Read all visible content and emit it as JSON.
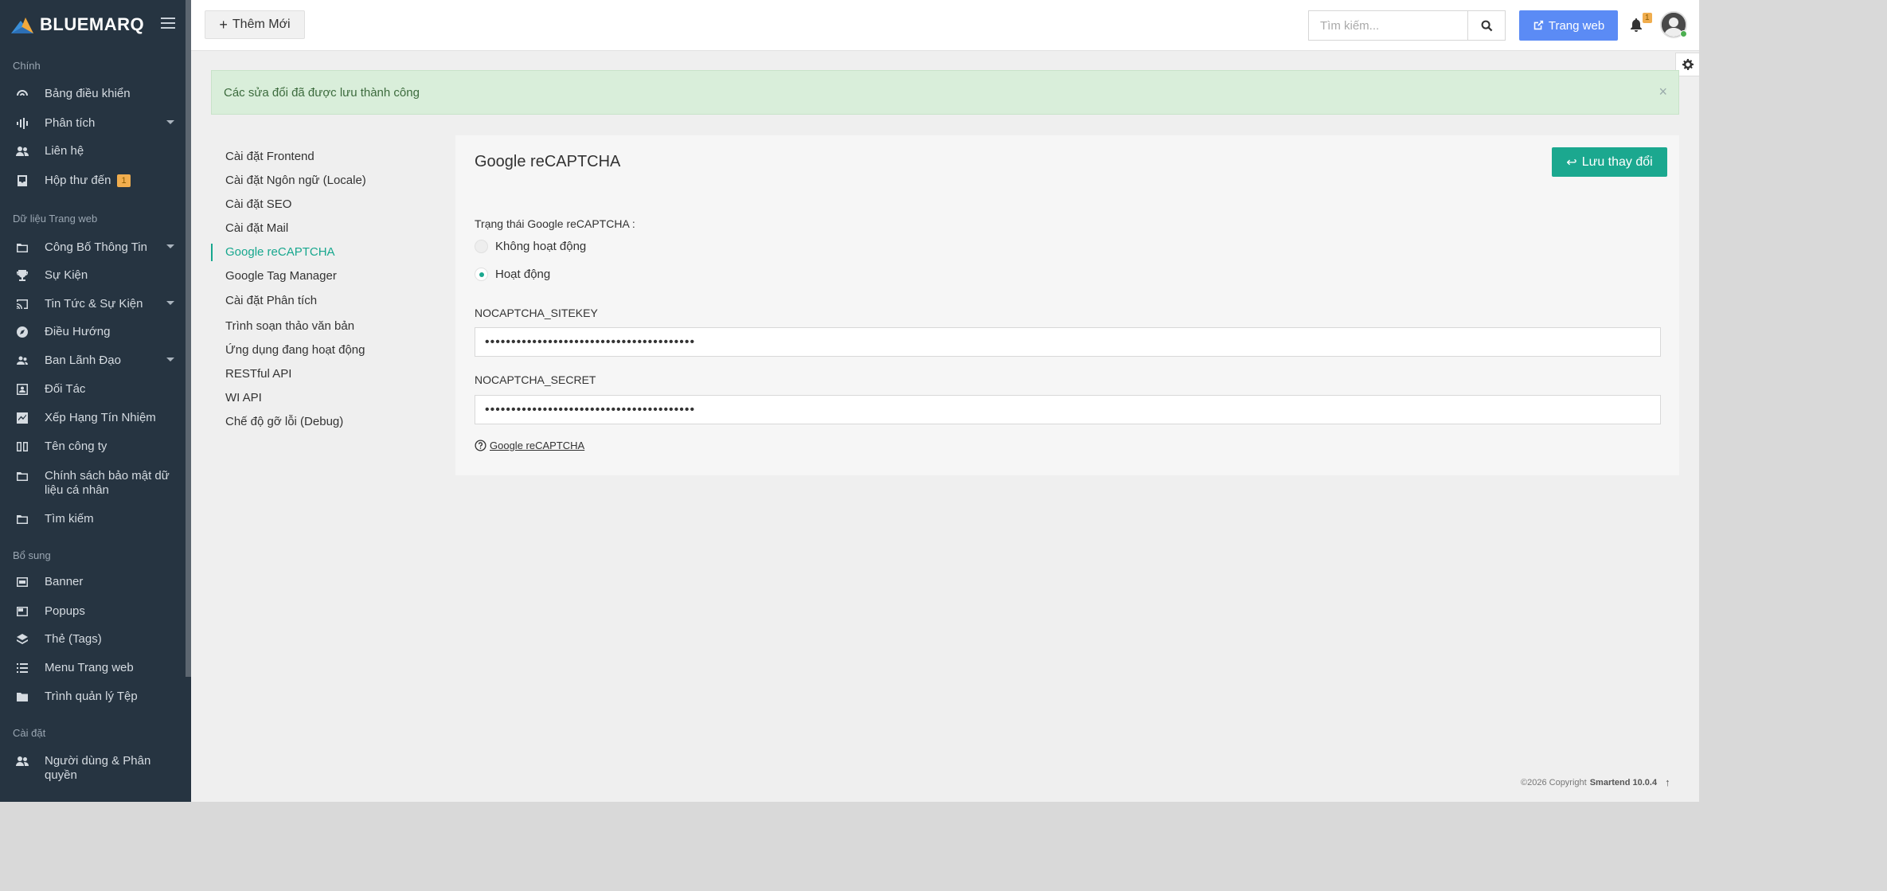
{
  "brand": {
    "name": "BLUEMARQ"
  },
  "sidebar": {
    "sections": [
      {
        "title": "Chính"
      },
      {
        "title": "Dữ liệu Trang web"
      },
      {
        "title": "Bổ sung"
      },
      {
        "title": "Cài đặt"
      }
    ],
    "items": [
      {
        "label": "Bảng điều khiển",
        "icon": "dashboard-icon"
      },
      {
        "label": "Phân tích",
        "icon": "analytics-icon"
      },
      {
        "label": "Liên hệ",
        "icon": "contacts-icon"
      },
      {
        "label": "Hộp thư đến",
        "icon": "inbox-icon",
        "badge": "1"
      },
      {
        "label": "Công Bố Thông Tin",
        "icon": "folder-icon"
      },
      {
        "label": "Sự Kiện",
        "icon": "trophy-icon"
      },
      {
        "label": "Tin Tức & Sự Kiện",
        "icon": "cast-icon"
      },
      {
        "label": "Điều Hướng",
        "icon": "compass-icon"
      },
      {
        "label": "Ban Lãnh Đạo",
        "icon": "people-icon"
      },
      {
        "label": "Đối Tác",
        "icon": "portrait-icon"
      },
      {
        "label": "Xếp Hạng Tín Nhiệm",
        "icon": "chart-icon"
      },
      {
        "label": "Tên công ty",
        "icon": "book-icon"
      },
      {
        "label": "Chính sách bảo mật dữ liệu cá nhân",
        "icon": "folder-icon"
      },
      {
        "label": "Tìm kiếm",
        "icon": "folder-icon"
      },
      {
        "label": "Banner",
        "icon": "banner-icon"
      },
      {
        "label": "Popups",
        "icon": "popup-icon"
      },
      {
        "label": "Thẻ (Tags)",
        "icon": "layers-icon"
      },
      {
        "label": "Menu Trang web",
        "icon": "list-icon"
      },
      {
        "label": "Trình quản lý Tệp",
        "icon": "folder-filled-icon"
      },
      {
        "label": "Người dùng & Phân quyền",
        "icon": "users-icon"
      }
    ]
  },
  "header": {
    "new_label": "Thêm Mới",
    "search_placeholder": "Tìm kiếm...",
    "website_label": "Trang web",
    "notif_count": "1"
  },
  "alert": {
    "text": "Các sửa đổi đã được lưu thành công",
    "close": "×"
  },
  "settings_nav": [
    {
      "label": "Cài đặt Frontend"
    },
    {
      "label": "Cài đặt Ngôn ngữ (Locale)"
    },
    {
      "label": "Cài đặt SEO"
    },
    {
      "label": "Cài đặt Mail"
    },
    {
      "label": "Google reCAPTCHA",
      "active": true
    },
    {
      "label": "Google Tag Manager"
    },
    {
      "label": "Cài đặt Phân tích"
    },
    {
      "label": "Trình soạn thảo văn bản"
    },
    {
      "label": "Ứng dụng đang hoạt động"
    },
    {
      "label": "RESTful API"
    },
    {
      "label": "WI API"
    },
    {
      "label": "Chế độ gỡ lỗi (Debug)"
    }
  ],
  "panel": {
    "title": "Google reCAPTCHA",
    "save_label": "Lưu thay đổi",
    "status_label": "Trạng thái Google reCAPTCHA :",
    "radio_off": "Không hoạt động",
    "radio_on": "Hoạt động",
    "selected": "Hoạt động",
    "sitekey_label": "NOCAPTCHA_SITEKEY",
    "sitekey_value": "••••••••••••••••••••••••••••••••••••••••",
    "secret_label": "NOCAPTCHA_SECRET",
    "secret_value": "••••••••••••••••••••••••••••••••••••••••",
    "help_link": "Google reCAPTCHA"
  },
  "footer": {
    "copyright": "©2026 Copyright",
    "product": "Smartend 10.0.4",
    "up": "↑"
  },
  "colors": {
    "sidebar": "#263441",
    "accent": "#1ba88f",
    "primary": "#5b8bf5",
    "alert_bg": "#d9eeda"
  }
}
